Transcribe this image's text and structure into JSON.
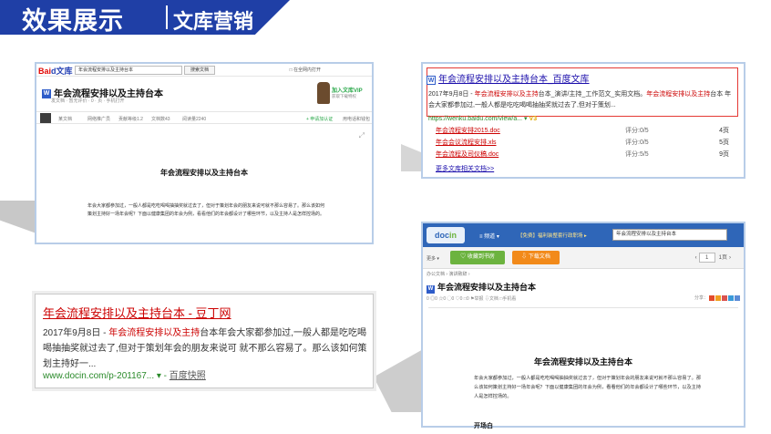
{
  "banner": {
    "title": "效果展示",
    "subtitle": "文库营销",
    "color": "#1f3fa6"
  },
  "wenku": {
    "logo_bai": "Bai",
    "logo_du": "d",
    "logo_site": "文库",
    "search_value": "年会流程安排以及主持台本",
    "search_button": "搜索文档",
    "topbar_right": "□ 在全网内打开",
    "doc_title": "年会流程安排以及主持台本",
    "meta": "发文档 · 暂无评价 · 0 · 页 · 手机打开",
    "vip_title": "加入文库VIP",
    "vip_sub": "获取下载特权",
    "user": "某文档",
    "bar_items": [
      "网络推广员",
      "贡献等级1.2",
      "文档数43",
      "阅读量2240"
    ],
    "share": "+ 申请加认证",
    "share2": "用电话和钱包",
    "expand_icon": "⤢",
    "content_title": "年会流程安排以及主持台本",
    "content_body": "年会大家都参加过，一般人都是吃吃喝喝抽抽奖就过去了，但对于策划年会的朋友来说可就不那么容易了。那么该如何策划主持好一场年会呢？下面以健康集团的年会为例，看看他们的年会都设计了哪些环节，以及主持人是怎样控场的。"
  },
  "serp_baidu": {
    "w_icon": "W",
    "title": "年会流程安排以及主持台本_百度文库",
    "snippet_date": "2017年9月8日 - ",
    "snippet_red": "年会流程安排以及主持",
    "snippet_mid": "台本_演讲/主持_工作范文_实用文档。",
    "snippet_red2": "年会流程安排以及主持",
    "snippet_tail": "台本 年会大家都参加过,一般人都是吃吃喝喝抽抽奖就过去了,但对于策划...",
    "url": "https://wenku.baidu.com/view/a... ▾",
    "url_badge": "V3",
    "related": [
      {
        "name": "年会流程安排2015.doc",
        "score": "评分:0/5",
        "pages": "4页"
      },
      {
        "name": "年会会议流程安排.xls",
        "score": "评分:0/5",
        "pages": "5页"
      },
      {
        "name": "年会流程及司仪稿.doc",
        "score": "评分:5/5",
        "pages": "9页"
      }
    ],
    "more": "更多文库相关文档>>"
  },
  "serp_docin": {
    "title": "年会流程安排以及主持台本 - 豆丁网",
    "snippet_date": "2017年9月8日 - ",
    "snippet_red": "年会流程安排以及主持",
    "snippet_tail": "台本年会大家都参加过,一般人都是吃吃喝喝抽抽奖就过去了,但对于策划年会的朋友来说可 就不那么容易了。那么该如何策划主持好一...",
    "url": "www.docin.com/p-201167... ▾ - ",
    "snapshot": "百度快照"
  },
  "docin": {
    "logo_a": "doc",
    "logo_b": "in",
    "nav_item": "≡ 频道 ▾",
    "nav_promo": "【免费】福利装整套行政职场 ▸",
    "search_value": "年会流程安排以及主持台本",
    "tools_more": "更多 ▾",
    "collect": "♡ 收藏到书房",
    "download": "⇩ 下载文档",
    "page_current": "1",
    "page_total": "1页",
    "crumb": "办公文档 › 演讲致辞 ›",
    "title_icon": "W",
    "title": "年会流程安排以及主持台本",
    "stats": "0  ◎0  ☆0  ◯0  ♡0  □0  ⚑举报  ⇩文档  □手机看",
    "share_label": "分享：",
    "content_title": "年会流程安排以及主持台本",
    "content_body": "年会大家都参加过，一般人都是吃吃喝喝抽抽奖就过去了，但对于策划年会的朋友来说可就不那么容易了。那么该如何策划主持好一场年会呢？下面以健康集团的年会为例，看看他们的年会都设计了哪些环节，以及主持人是怎样控场的。",
    "section": "开场白"
  }
}
